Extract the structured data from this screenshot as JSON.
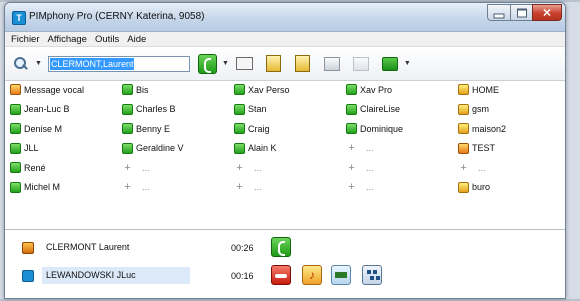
{
  "window": {
    "title": "PIMphony Pro (CERNY Katerina, 9058)",
    "app_icon_glyph": "T"
  },
  "menu": [
    "Fichier",
    "Affichage",
    "Outils",
    "Aide"
  ],
  "toolbar": {
    "search_value": "CLERMONT,Laurent"
  },
  "speed_dial": {
    "rows": [
      [
        {
          "label": "Message vocal",
          "icon": "voicemail-icon",
          "color": "orange"
        },
        {
          "label": "Bis",
          "icon": "phone-icon",
          "color": "green"
        },
        {
          "label": "Xav Perso",
          "icon": "phone-icon",
          "color": "green"
        },
        {
          "label": "Xav Pro",
          "icon": "phone-icon",
          "color": "green"
        },
        {
          "label": "HOME",
          "icon": "phone-icon",
          "color": "yellow"
        }
      ],
      [
        {
          "label": "Jean-Luc B",
          "icon": "phone-icon",
          "color": "green"
        },
        {
          "label": "Charles B",
          "icon": "phone-icon",
          "color": "green"
        },
        {
          "label": "Stan",
          "icon": "phone-icon",
          "color": "green"
        },
        {
          "label": "ClaireLise",
          "icon": "phone-icon",
          "color": "green"
        },
        {
          "label": "gsm",
          "icon": "phone-icon",
          "color": "yellow"
        }
      ],
      [
        {
          "label": "Denise M",
          "icon": "phone-icon",
          "color": "green"
        },
        {
          "label": "Benny E",
          "icon": "phone-icon",
          "color": "green"
        },
        {
          "label": "Craig",
          "icon": "phone-icon",
          "color": "green"
        },
        {
          "label": "Dominique",
          "icon": "phone-icon",
          "color": "green"
        },
        {
          "label": "maison2",
          "icon": "phone-icon",
          "color": "yellow"
        }
      ],
      [
        {
          "label": "JLL",
          "icon": "phone-icon",
          "color": "green"
        },
        {
          "label": "Geraldine V",
          "icon": "phone-icon",
          "color": "green"
        },
        {
          "label": "Alain K",
          "icon": "phone-icon",
          "color": "green"
        },
        {
          "label": "...",
          "icon": "plus-icon",
          "color": "empty"
        },
        {
          "label": "TEST",
          "icon": "phone-icon",
          "color": "orange"
        }
      ],
      [
        {
          "label": "René",
          "icon": "phone-icon",
          "color": "green"
        },
        {
          "label": "...",
          "icon": "plus-icon",
          "color": "empty"
        },
        {
          "label": "...",
          "icon": "plus-icon",
          "color": "empty"
        },
        {
          "label": "...",
          "icon": "plus-icon",
          "color": "empty"
        },
        {
          "label": "...",
          "icon": "plus-icon",
          "color": "empty"
        }
      ],
      [
        {
          "label": "Michel M",
          "icon": "phone-icon",
          "color": "green"
        },
        {
          "label": "...",
          "icon": "plus-icon",
          "color": "empty"
        },
        {
          "label": "...",
          "icon": "plus-icon",
          "color": "empty"
        },
        {
          "label": "...",
          "icon": "plus-icon",
          "color": "empty"
        },
        {
          "label": "buro",
          "icon": "phone-icon",
          "color": "yellow"
        }
      ]
    ]
  },
  "calls": [
    {
      "name": "CLERMONT Laurent",
      "time": "00:26",
      "selected": false
    },
    {
      "name": "LEWANDOWSKI JLuc",
      "time": "00:16",
      "selected": true
    }
  ],
  "plus_glyph": "+"
}
